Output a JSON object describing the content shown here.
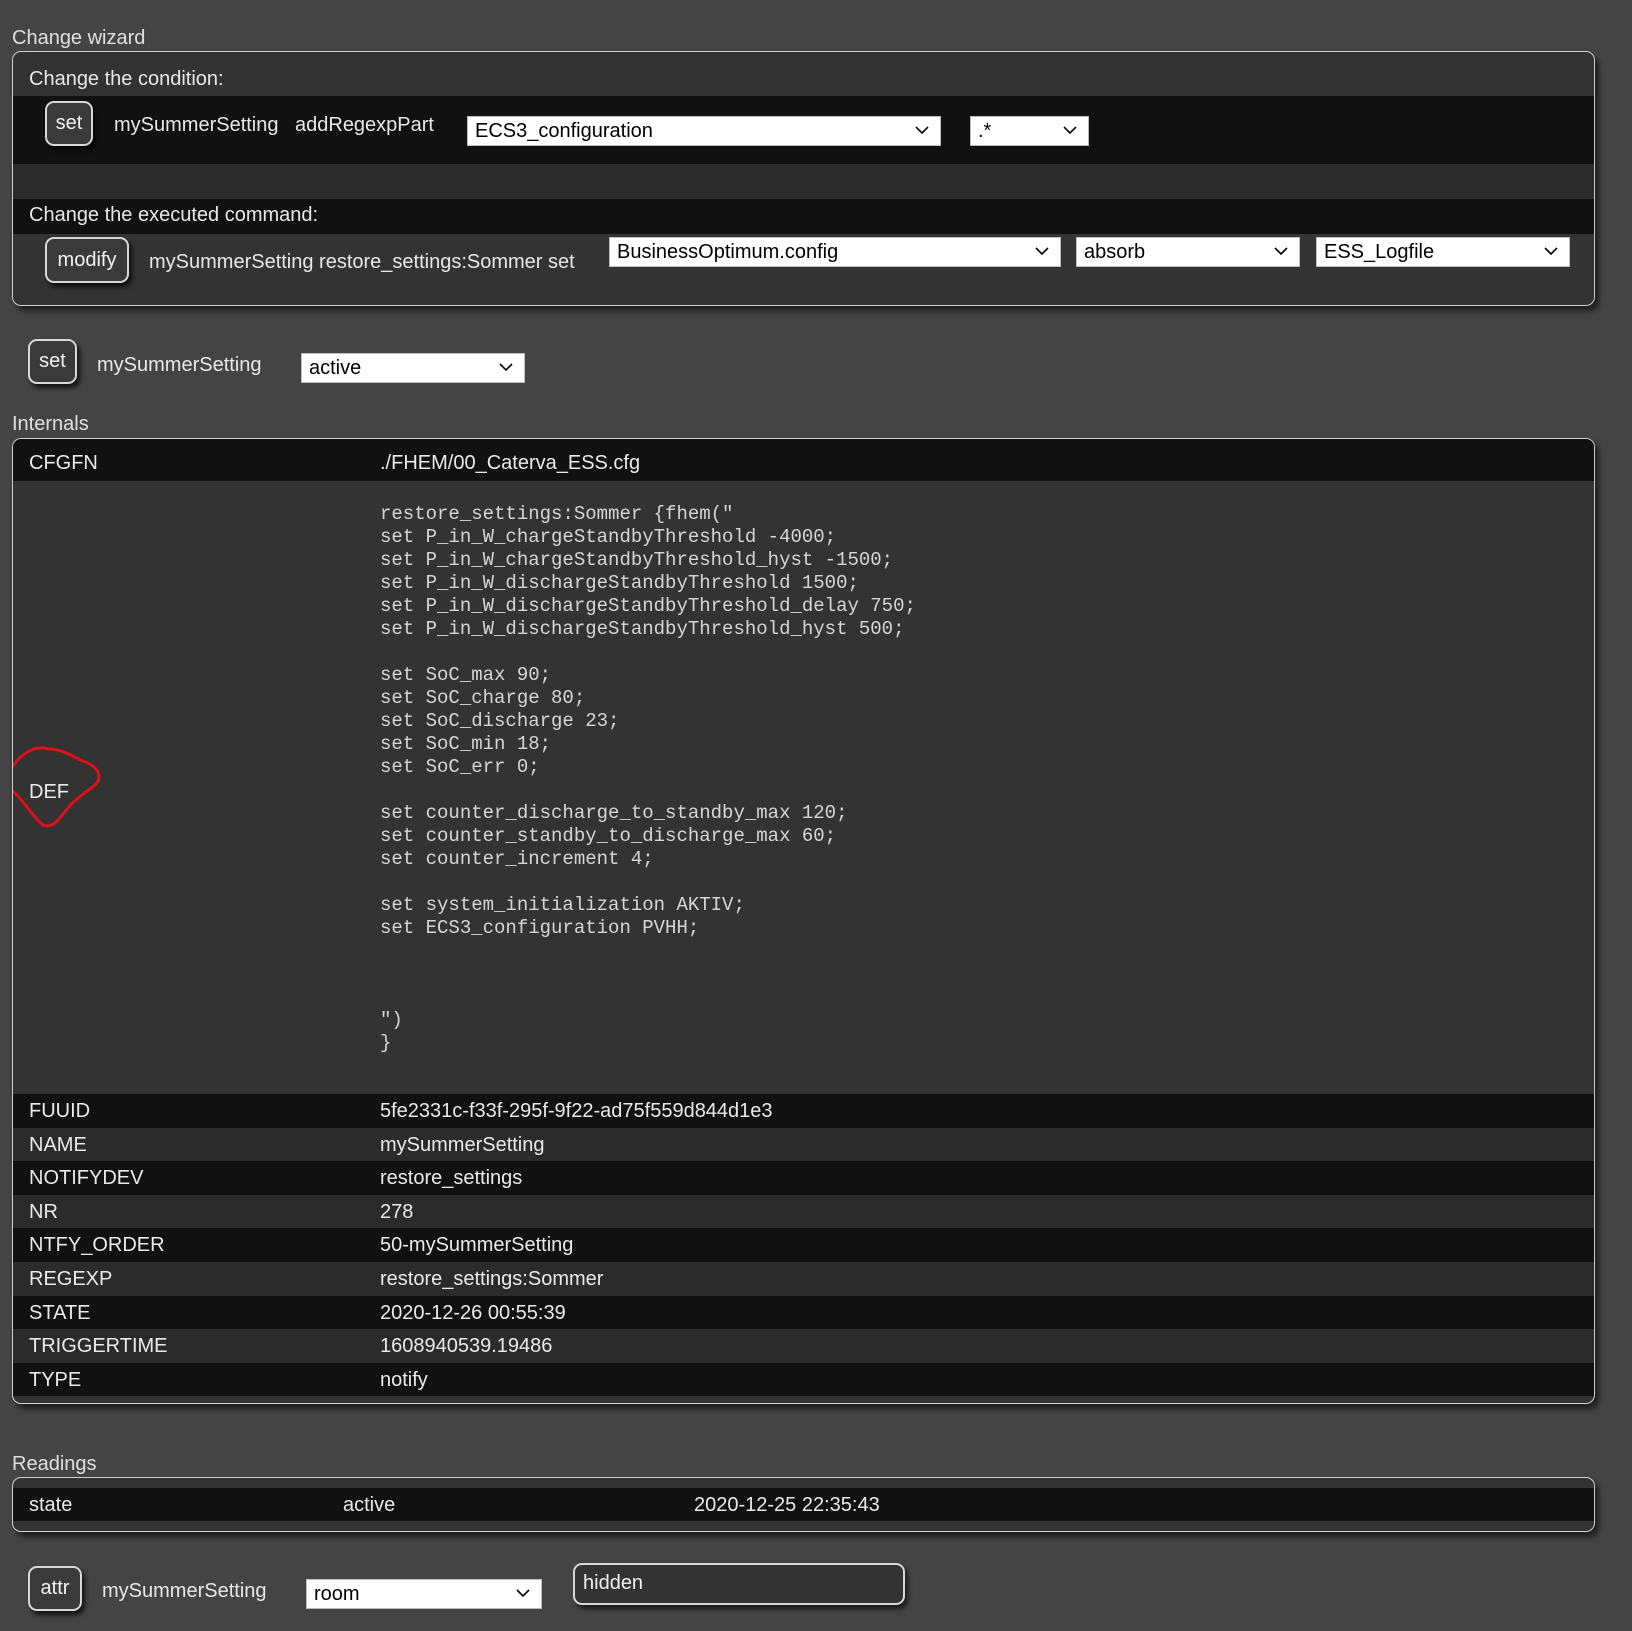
{
  "change_wizard": {
    "title": "Change wizard",
    "condition_label": "Change the condition:",
    "condition_button": "set",
    "condition_device": "mySummerSetting",
    "condition_command": "addRegexpPart",
    "condition_select1": "ECS3_configuration",
    "condition_select2": ".*",
    "command_label": "Change the executed command:",
    "command_button": "modify",
    "command_text": "mySummerSetting restore_settings:Sommer set",
    "command_select1": "BusinessOptimum.config",
    "command_select2": "absorb",
    "command_select3": "ESS_Logfile"
  },
  "set_row": {
    "button": "set",
    "device": "mySummerSetting",
    "select": "active"
  },
  "internals": {
    "title": "Internals",
    "cfgfn": {
      "key": "CFGFN",
      "value": "./FHEM/00_Caterva_ESS.cfg"
    },
    "def": {
      "key": "DEF",
      "value": "restore_settings:Sommer {fhem(\"\nset P_in_W_chargeStandbyThreshold -4000;\nset P_in_W_chargeStandbyThreshold_hyst -1500;\nset P_in_W_dischargeStandbyThreshold 1500;\nset P_in_W_dischargeStandbyThreshold_delay 750;\nset P_in_W_dischargeStandbyThreshold_hyst 500;\n\nset SoC_max 90;\nset SoC_charge 80;\nset SoC_discharge 23;\nset SoC_min 18;\nset SoC_err 0;\n\nset counter_discharge_to_standby_max 120;\nset counter_standby_to_discharge_max 60;\nset counter_increment 4;\n\nset system_initialization AKTIV;\nset ECS3_configuration PVHH;\n\n\n\n\")\n}"
    },
    "rows": [
      {
        "key": "FUUID",
        "value": "5fe2331c-f33f-295f-9f22-ad75f559d844d1e3"
      },
      {
        "key": "NAME",
        "value": "mySummerSetting"
      },
      {
        "key": "NOTIFYDEV",
        "value": "restore_settings"
      },
      {
        "key": "NR",
        "value": "278"
      },
      {
        "key": "NTFY_ORDER",
        "value": "50-mySummerSetting"
      },
      {
        "key": "REGEXP",
        "value": "restore_settings:Sommer"
      },
      {
        "key": "STATE",
        "value": "2020-12-26 00:55:39"
      },
      {
        "key": "TRIGGERTIME",
        "value": "1608940539.19486"
      },
      {
        "key": "TYPE",
        "value": "notify"
      }
    ]
  },
  "readings": {
    "title": "Readings",
    "rows": [
      {
        "name": "state",
        "value": "active",
        "time": "2020-12-25 22:35:43"
      }
    ]
  },
  "attr_row": {
    "button": "attr",
    "device": "mySummerSetting",
    "select": "room",
    "input_value": "hidden"
  },
  "colors": {
    "page_bg": "#444444",
    "panel_bg": "#333333",
    "row_dark": "#111111",
    "annotation": "#e0111a"
  }
}
